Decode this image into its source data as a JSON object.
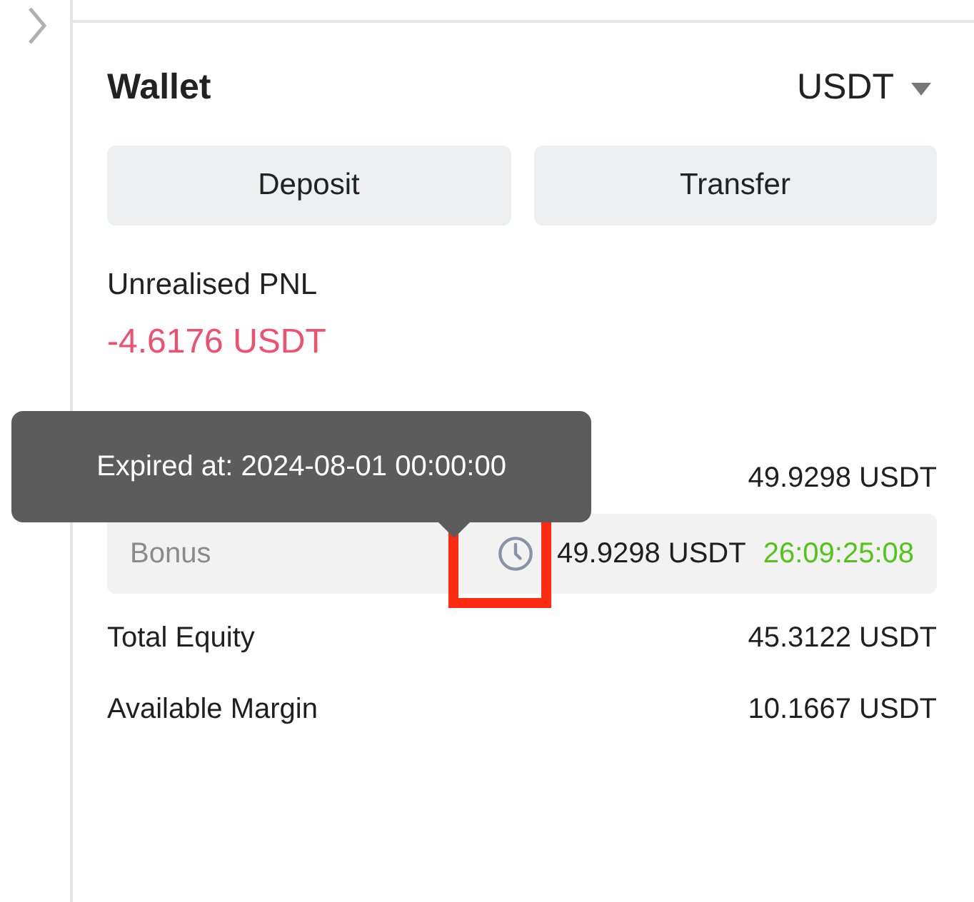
{
  "wallet": {
    "title": "Wallet",
    "currency": "USDT"
  },
  "buttons": [
    "Deposit",
    "Transfer"
  ],
  "pnl": {
    "label": "Unrealised PNL",
    "value": "-4.6176 USDT"
  },
  "tooltip": {
    "text": "Expired at: 2024-08-01 00:00:00"
  },
  "rows": [
    {
      "kind": "plain",
      "value": "49.9298 USDT"
    },
    {
      "kind": "bonus",
      "label": "Bonus",
      "value": "49.9298 USDT",
      "countdown": "26:09:25:08"
    },
    {
      "kind": "plain",
      "label": "Total Equity",
      "value": "45.3122 USDT"
    },
    {
      "kind": "plain",
      "label": "Available Margin",
      "value": "10.1667 USDT"
    }
  ]
}
